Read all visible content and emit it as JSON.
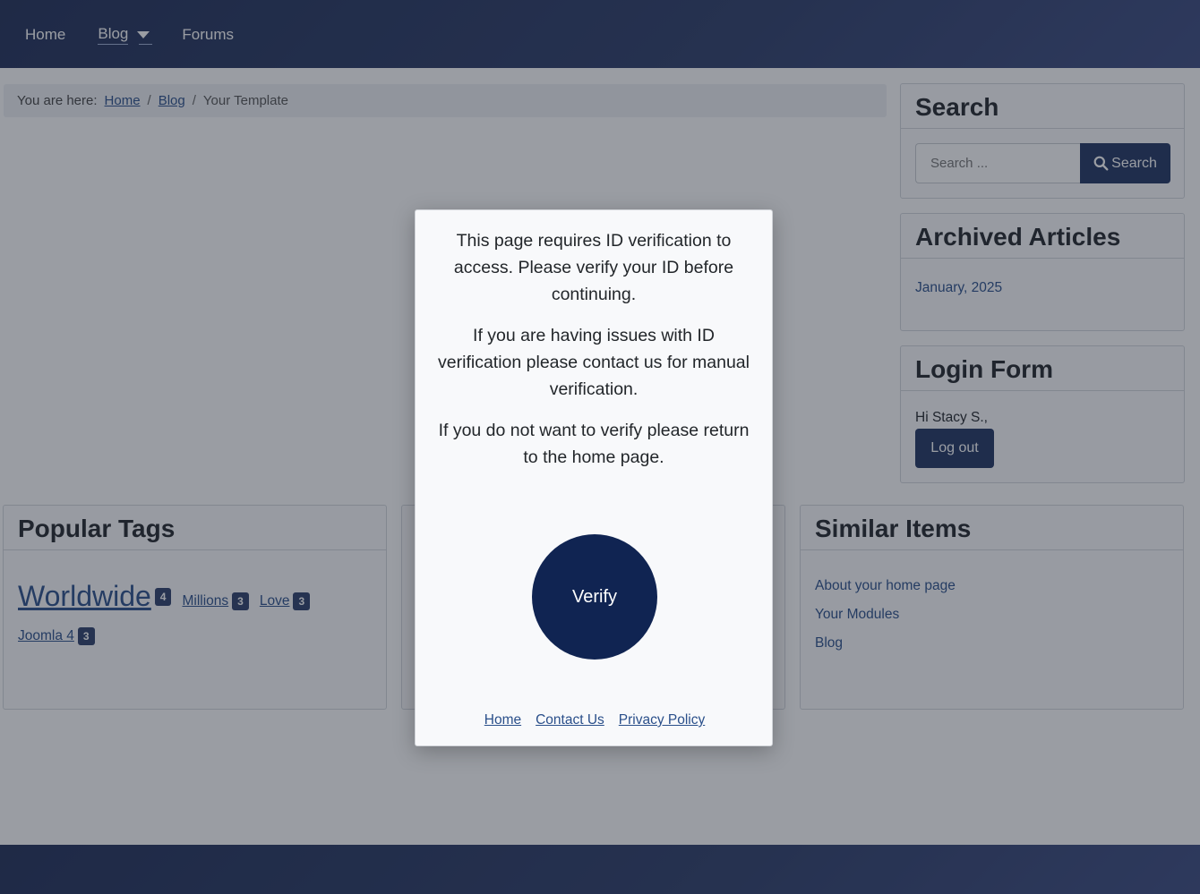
{
  "nav": {
    "items": [
      {
        "label": "Home"
      },
      {
        "label": "Blog"
      },
      {
        "label": "Forums"
      }
    ]
  },
  "breadcrumb": {
    "prefix": "You are here:",
    "items": [
      "Home",
      "Blog"
    ],
    "separator": "/",
    "current": "Your Template"
  },
  "search": {
    "title": "Search",
    "placeholder": "Search ...",
    "button_label": "Search"
  },
  "archived": {
    "title": "Archived Articles",
    "items": [
      "January, 2025"
    ]
  },
  "login": {
    "title": "Login Form",
    "greeting": "Hi Stacy S.,",
    "logout_label": "Log out"
  },
  "popular_tags": {
    "title": "Popular Tags",
    "tags": [
      {
        "label": "Worldwide",
        "count": "4"
      },
      {
        "label": "Millions",
        "count": "3"
      },
      {
        "label": "Love",
        "count": "3"
      },
      {
        "label": "Joomla 4",
        "count": "3"
      }
    ]
  },
  "similar_items": {
    "title": "Similar Items",
    "items": [
      "About your home page",
      "Your Modules",
      "Blog"
    ]
  },
  "modal": {
    "paragraphs": [
      "This page requires ID verification to access. Please verify your ID before continuing.",
      "If you are having issues with ID verification please contact us for manual verification.",
      "If you do not want to verify please return to the home page."
    ],
    "verify_label": "Verify",
    "links": [
      "Home",
      "Contact Us",
      "Privacy Policy"
    ]
  },
  "colors": {
    "primary": "#1f3462",
    "verify_button": "#102452",
    "link": "#2a4f8a"
  }
}
